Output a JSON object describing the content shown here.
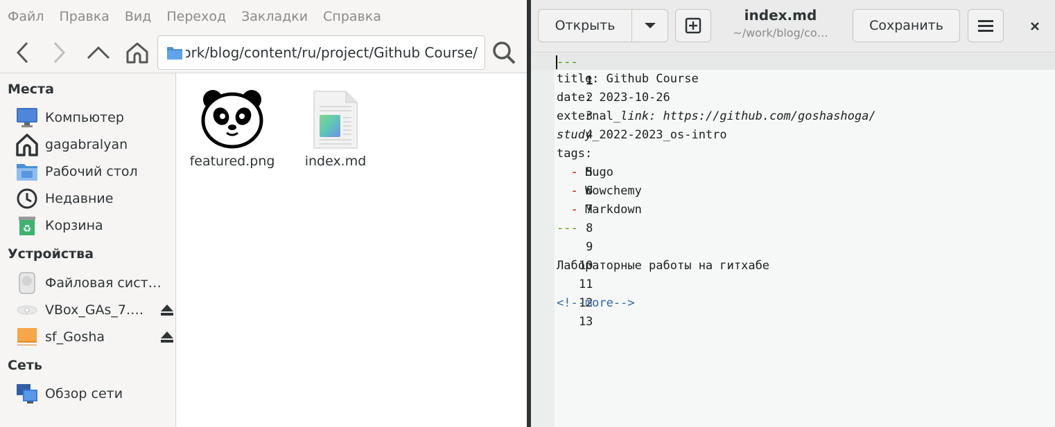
{
  "file_manager": {
    "menu": [
      "Файл",
      "Правка",
      "Вид",
      "Переход",
      "Закладки",
      "Справка"
    ],
    "location": ".../work/blog/content/ru/project/Github Course/",
    "location_visible": "ork/blog/content/ru/project/Github Course/",
    "sidebar": {
      "places_heading": "Места",
      "places": [
        {
          "label": "Компьютер",
          "icon": "computer-icon"
        },
        {
          "label": "gagabralyan",
          "icon": "home-icon"
        },
        {
          "label": "Рабочий стол",
          "icon": "desktop-folder-icon"
        },
        {
          "label": "Недавние",
          "icon": "clock-icon"
        },
        {
          "label": "Корзина",
          "icon": "trash-icon"
        }
      ],
      "devices_heading": "Устройства",
      "devices": [
        {
          "label": "Файловая сист…",
          "icon": "drive-icon"
        },
        {
          "label": "VBox_GAs_7.…",
          "icon": "optical-disc-icon",
          "eject": true
        },
        {
          "label": "sf_Gosha",
          "icon": "shared-folder-icon",
          "eject": true
        }
      ],
      "network_heading": "Сеть",
      "network": [
        {
          "label": "Обзор сети",
          "icon": "network-icon"
        }
      ]
    },
    "files": [
      {
        "name": "featured.png",
        "icon": "panda-image-icon"
      },
      {
        "name": "index.md",
        "icon": "markdown-file-icon"
      }
    ]
  },
  "editor": {
    "open_label": "Открыть",
    "save_label": "Сохранить",
    "title": "index.md",
    "path": "~/work/blog/co…",
    "lines": [
      {
        "n": "1",
        "text": "---"
      },
      {
        "n": "2",
        "text": "title: Github Course"
      },
      {
        "n": "3",
        "text": "date: 2023-10-26"
      },
      {
        "n": "4",
        "key": "external_",
        "key_italic": "link:",
        "value": " https://github.com/goshashoga/"
      },
      {
        "n": "",
        "value": "study_",
        "value_rest": "2022-2023_os-intro"
      },
      {
        "n": "5",
        "text": "tags:"
      },
      {
        "n": "6",
        "dash": "-",
        "text": " Hugo"
      },
      {
        "n": "7",
        "dash": "-",
        "text": " Wowchemy"
      },
      {
        "n": "8",
        "dash": "-",
        "text": " Markdown"
      },
      {
        "n": "9",
        "text": "---"
      },
      {
        "n": "10",
        "text": ""
      },
      {
        "n": "11",
        "text": "Лабораторные работы на гитхабе"
      },
      {
        "n": "12",
        "text": ""
      },
      {
        "n": "13",
        "text": "<!--more-->"
      }
    ]
  }
}
